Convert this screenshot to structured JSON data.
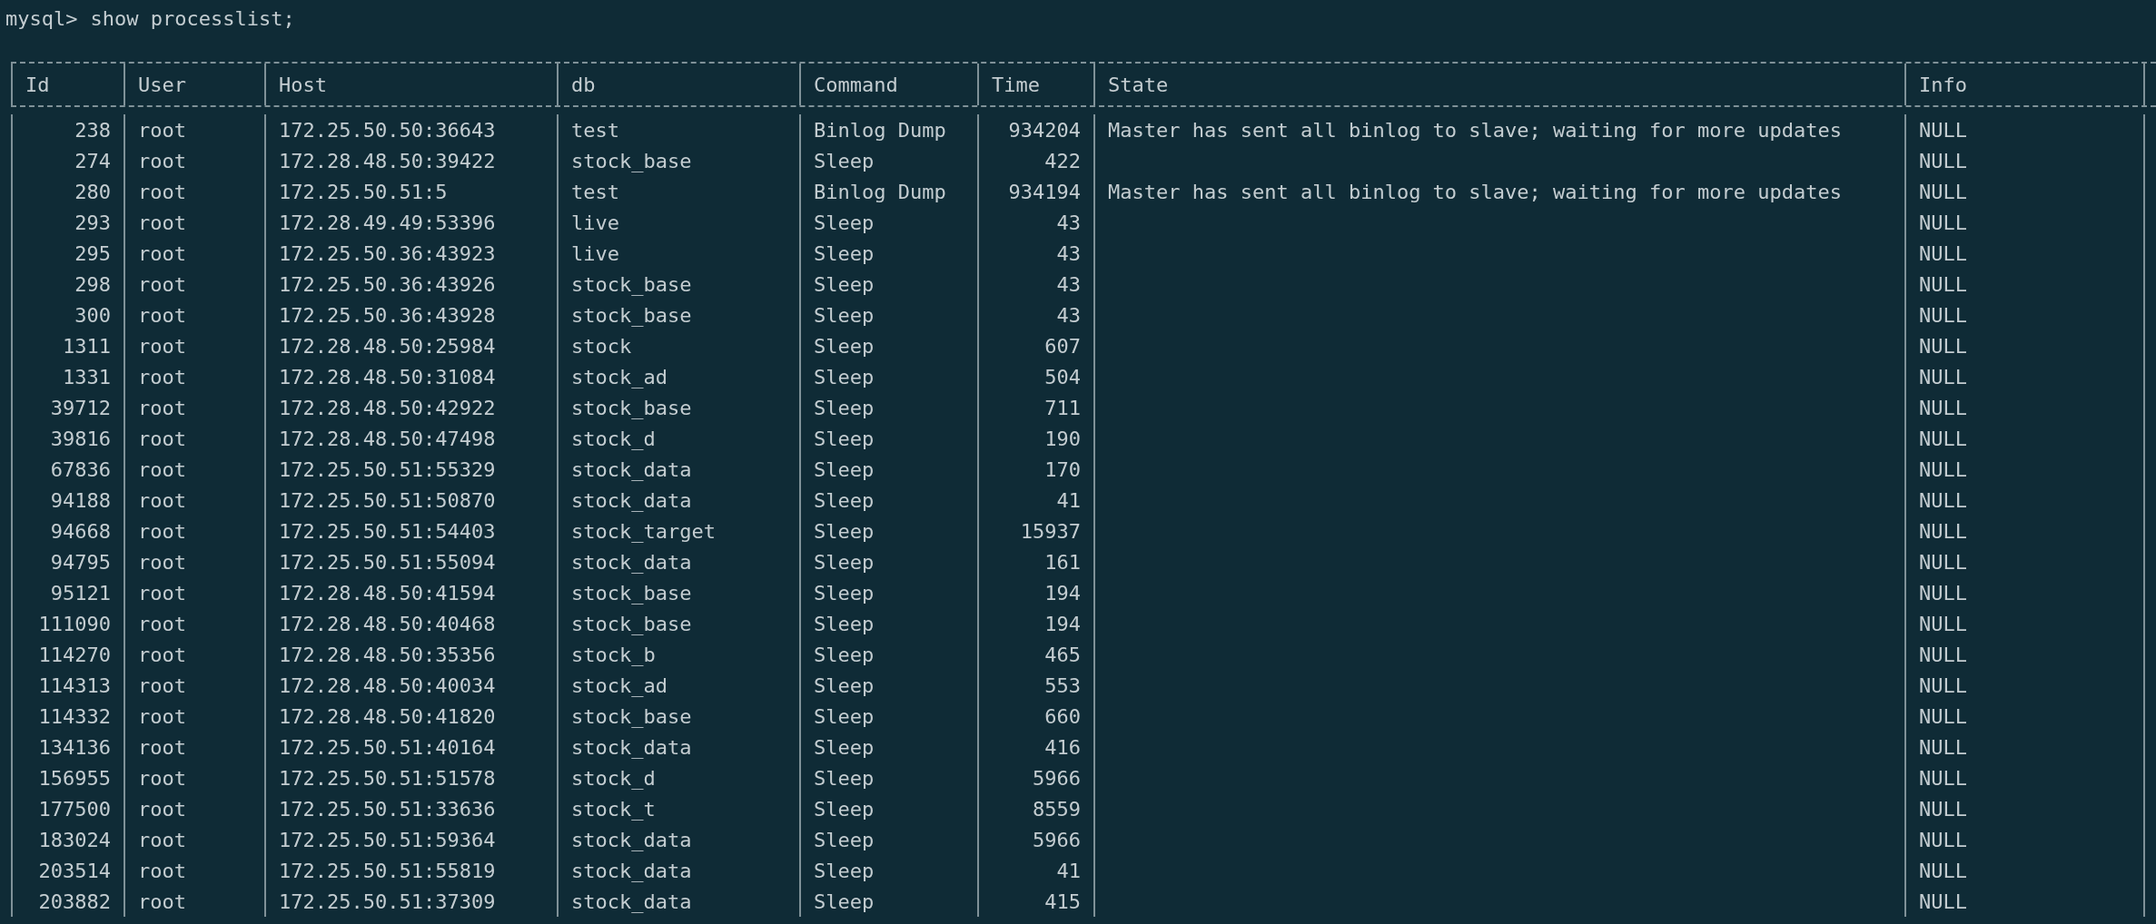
{
  "terminal": {
    "prompt": "mysql>",
    "command": "show processlist;"
  },
  "table": {
    "columns": [
      {
        "label": "Id",
        "kind": "number"
      },
      {
        "label": "User",
        "kind": "text"
      },
      {
        "label": "Host",
        "kind": "text"
      },
      {
        "label": "db",
        "kind": "text"
      },
      {
        "label": "Command",
        "kind": "text"
      },
      {
        "label": "Time",
        "kind": "number"
      },
      {
        "label": "State",
        "kind": "text"
      },
      {
        "label": "Info",
        "kind": "text"
      }
    ],
    "rows": [
      {
        "id": "238",
        "user": "root",
        "host": "172.25.50.50:36643",
        "db": "test",
        "command": "Binlog Dump",
        "time": "934204",
        "state": "Master has sent all binlog to slave; waiting for more updates",
        "info": "NULL"
      },
      {
        "id": "274",
        "user": "root",
        "host": "172.28.48.50:39422",
        "db": "stock_base",
        "command": "Sleep",
        "time": "422",
        "info": "NULL"
      },
      {
        "id": "280",
        "user": "root",
        "host": "172.25.50.51:5",
        "db": "test",
        "command": "Binlog Dump",
        "time": "934194",
        "state": "Master has sent all binlog to slave; waiting for more updates",
        "info": "NULL"
      },
      {
        "id": "293",
        "user": "root",
        "host": "172.28.49.49:53396",
        "db": "live",
        "command": "Sleep",
        "time": "43",
        "info": "NULL"
      },
      {
        "id": "295",
        "user": "root",
        "host": "172.25.50.36:43923",
        "db": "live",
        "command": "Sleep",
        "time": "43",
        "info": "NULL"
      },
      {
        "id": "298",
        "user": "root",
        "host": "172.25.50.36:43926",
        "db": "stock_base",
        "command": "Sleep",
        "time": "43",
        "info": "NULL"
      },
      {
        "id": "300",
        "user": "root",
        "host": "172.25.50.36:43928",
        "db": "stock_base",
        "command": "Sleep",
        "time": "43",
        "info": "NULL"
      },
      {
        "id": "1311",
        "user": "root",
        "host": "172.28.48.50:25984",
        "db": "stock",
        "command": "Sleep",
        "time": "607",
        "info": "NULL"
      },
      {
        "id": "1331",
        "user": "root",
        "host": "172.28.48.50:31084",
        "db": "stock_ad",
        "command": "Sleep",
        "time": "504",
        "info": "NULL"
      },
      {
        "id": "39712",
        "user": "root",
        "host": "172.28.48.50:42922",
        "db": "stock_base",
        "command": "Sleep",
        "time": "711",
        "info": "NULL"
      },
      {
        "id": "39816",
        "user": "root",
        "host": "172.28.48.50:47498",
        "db": "stock_d",
        "command": "Sleep",
        "time": "190",
        "info": "NULL"
      },
      {
        "id": "67836",
        "user": "root",
        "host": "172.25.50.51:55329",
        "db": "stock_data",
        "command": "Sleep",
        "time": "170",
        "info": "NULL"
      },
      {
        "id": "94188",
        "user": "root",
        "host": "172.25.50.51:50870",
        "db": "stock_data",
        "command": "Sleep",
        "time": "41",
        "info": "NULL"
      },
      {
        "id": "94668",
        "user": "root",
        "host": "172.25.50.51:54403",
        "db": "stock_target",
        "command": "Sleep",
        "time": "15937",
        "info": "NULL"
      },
      {
        "id": "94795",
        "user": "root",
        "host": "172.25.50.51:55094",
        "db": "stock_data",
        "command": "Sleep",
        "time": "161",
        "info": "NULL"
      },
      {
        "id": "95121",
        "user": "root",
        "host": "172.28.48.50:41594",
        "db": "stock_base",
        "command": "Sleep",
        "time": "194",
        "info": "NULL"
      },
      {
        "id": "111090",
        "user": "root",
        "host": "172.28.48.50:40468",
        "db": "stock_base",
        "command": "Sleep",
        "time": "194",
        "info": "NULL"
      },
      {
        "id": "114270",
        "user": "root",
        "host": "172.28.48.50:35356",
        "db": "stock_b",
        "command": "Sleep",
        "time": "465",
        "info": "NULL"
      },
      {
        "id": "114313",
        "user": "root",
        "host": "172.28.48.50:40034",
        "db": "stock_ad",
        "command": "Sleep",
        "time": "553",
        "info": "NULL"
      },
      {
        "id": "114332",
        "user": "root",
        "host": "172.28.48.50:41820",
        "db": "stock_base",
        "command": "Sleep",
        "time": "660",
        "info": "NULL"
      },
      {
        "id": "134136",
        "user": "root",
        "host": "172.25.50.51:40164",
        "db": "stock_data",
        "command": "Sleep",
        "time": "416",
        "info": "NULL"
      },
      {
        "id": "156955",
        "user": "root",
        "host": "172.25.50.51:51578",
        "db": "stock_d",
        "command": "Sleep",
        "time": "5966",
        "info": "NULL"
      },
      {
        "id": "177500",
        "user": "root",
        "host": "172.25.50.51:33636",
        "db": "stock_t",
        "command": "Sleep",
        "time": "8559",
        "info": "NULL"
      },
      {
        "id": "183024",
        "user": "root",
        "host": "172.25.50.51:59364",
        "db": "stock_data",
        "command": "Sleep",
        "time": "5966",
        "info": "NULL"
      },
      {
        "id": "203514",
        "user": "root",
        "host": "172.25.50.51:55819",
        "db": "stock_data",
        "command": "Sleep",
        "time": "41",
        "info": "NULL"
      },
      {
        "id": "203882",
        "user": "root",
        "host": "172.25.50.51:37309",
        "db": "stock_data",
        "command": "Sleep",
        "time": "415",
        "info": "NULL"
      }
    ]
  }
}
